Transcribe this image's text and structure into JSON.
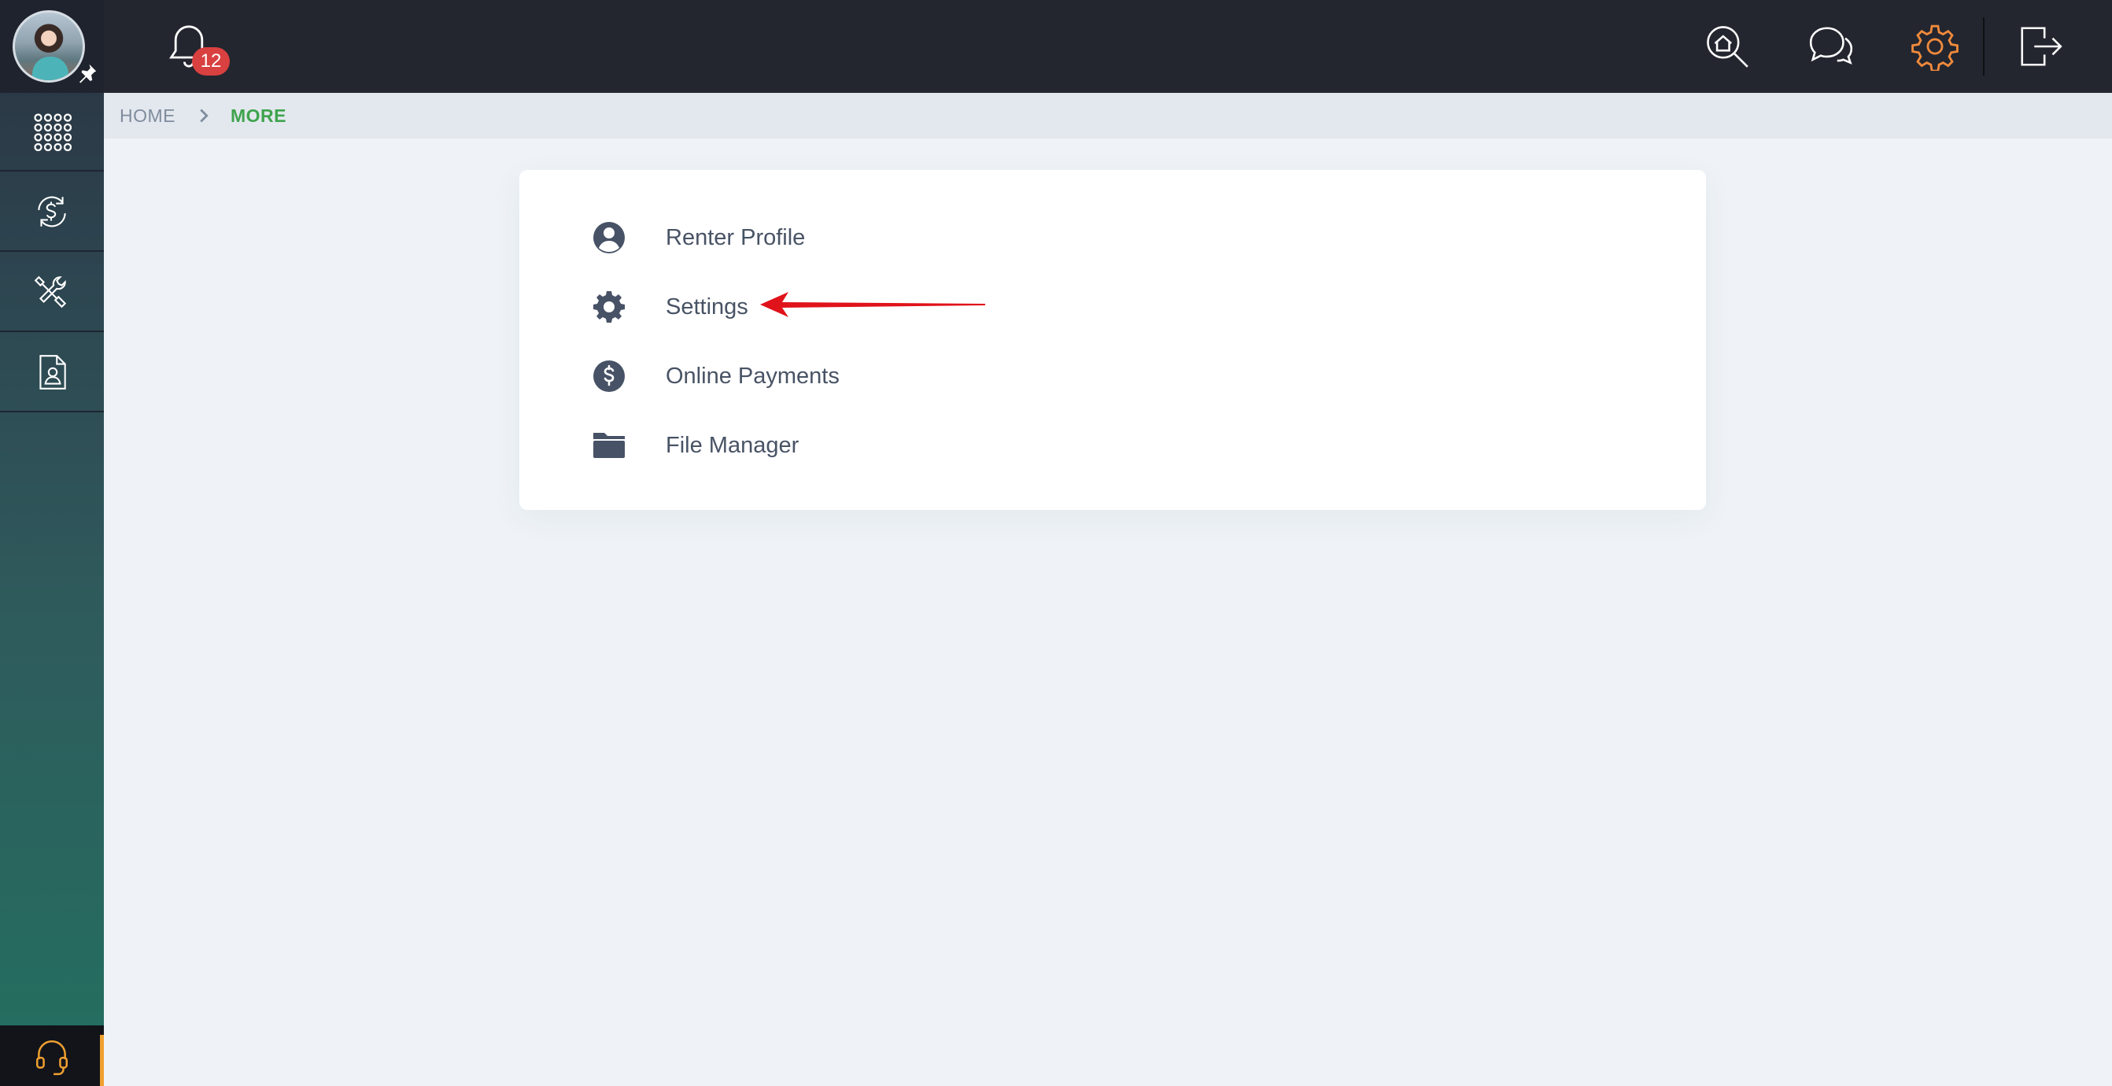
{
  "topbar": {
    "notifications_count": "12",
    "icons": [
      "bell-icon",
      "home-search-icon",
      "chat-icon",
      "gear-icon",
      "logout-icon"
    ],
    "active_color": "#f08a3c"
  },
  "sidebar": {
    "items": [
      {
        "name": "apps-grid-icon"
      },
      {
        "name": "payments-exchange-icon"
      },
      {
        "name": "tools-icon"
      },
      {
        "name": "document-profile-icon"
      }
    ],
    "support_icon": "headset-icon"
  },
  "breadcrumb": {
    "home": "HOME",
    "current": "MORE"
  },
  "menu": {
    "items": [
      {
        "label": "Renter Profile",
        "icon": "user-circle-icon"
      },
      {
        "label": "Settings",
        "icon": "gear-icon"
      },
      {
        "label": "Online Payments",
        "icon": "dollar-circle-icon"
      },
      {
        "label": "File Manager",
        "icon": "folder-icon"
      }
    ]
  },
  "annotation": {
    "type": "red-arrow",
    "points_to": "Settings",
    "color": "#e0121a"
  },
  "colors": {
    "topbar_bg": "#23262f",
    "breadcrumb_active": "#3fa34d",
    "badge_bg": "#d94040"
  }
}
